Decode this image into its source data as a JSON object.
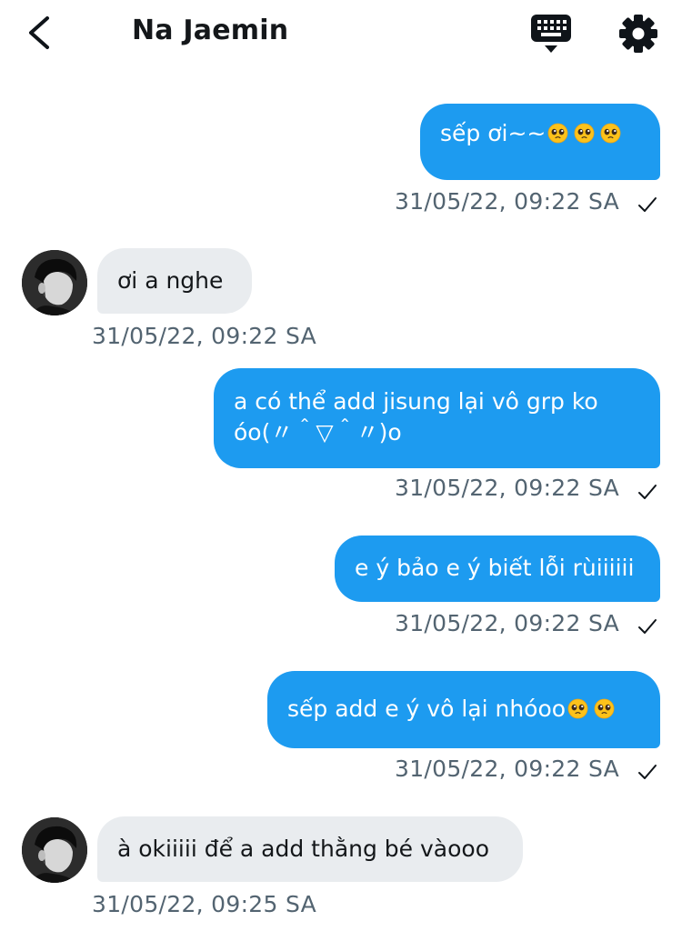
{
  "header": {
    "title": "Na Jaemin",
    "back_icon": "chevron-left-icon",
    "keyboard_icon": "keyboard-icon",
    "settings_icon": "gear-icon"
  },
  "colors": {
    "sent_bubble": "#1d9bf0",
    "received_bubble": "#e9ecef",
    "timestamp": "#536471"
  },
  "messages": [
    {
      "direction": "sent",
      "text": "sếp ơi~~",
      "emojis": 3,
      "timestamp": "31/05/22, 09:22 SA",
      "read": true
    },
    {
      "direction": "received",
      "text": "ơi a nghe",
      "timestamp": "31/05/22, 09:22 SA"
    },
    {
      "direction": "sent",
      "line1": "a có thể add jisung lại vô grp ko",
      "line2": "óo(〃＾▽＾〃)o",
      "timestamp": "31/05/22, 09:22 SA",
      "read": true
    },
    {
      "direction": "sent",
      "text": "e ý bảo e ý biết lỗi rùiiiiii",
      "timestamp": "31/05/22, 09:22 SA",
      "read": true
    },
    {
      "direction": "sent",
      "text": "sếp add e ý vô lại nhóoo",
      "emojis": 2,
      "timestamp": "31/05/22, 09:22 SA",
      "read": true
    },
    {
      "direction": "received",
      "text": "à okiiiii để a add thằng bé vàooo",
      "timestamp": "31/05/22, 09:25 SA"
    }
  ]
}
